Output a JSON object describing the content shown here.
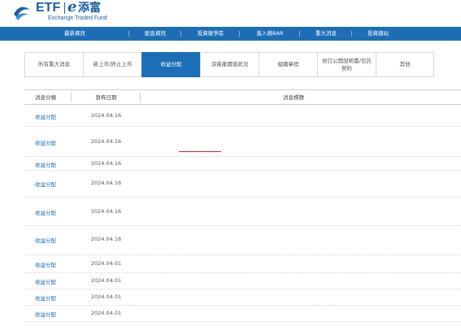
{
  "brand": {
    "etf": "ETF",
    "separator": "|",
    "e_mark": "e",
    "chinese": "添富",
    "subtitle": "Exchange Traded Fund",
    "logo_icon": "wave-logo-icon",
    "color": "#1a5fa0"
  },
  "top_nav": {
    "color": "#1c6fb7",
    "items": [
      "最新資訊",
      "配息資訊",
      "投資競爭區",
      "進入競BAR",
      "重大消息",
      "投資總站"
    ]
  },
  "tabs": {
    "active_index": 2,
    "items": [
      "所有重大消息",
      "新上市/終止上市",
      "收益分配",
      "淨資產價值狀況",
      "組織章程",
      "修訂公開說明書/信託契約",
      "其他"
    ]
  },
  "table": {
    "headers": {
      "category": "消息分類",
      "date": "發佈日期",
      "title": "消息標題"
    },
    "rows": [
      {
        "category": "收益分配",
        "date": "2024.04.16",
        "title": ""
      },
      {
        "category": "收益分配",
        "date": "2024.04.16",
        "title": ""
      },
      {
        "category": "收益分配",
        "date": "2024.04.16",
        "title": ""
      },
      {
        "category": "收益分配",
        "date": "2024.04.16",
        "title": ""
      },
      {
        "category": "收益分配",
        "date": "2024.04.16",
        "title": ""
      },
      {
        "category": "收益分配",
        "date": "2024.04.16",
        "title": ""
      },
      {
        "category": "收益分配",
        "date": "2024.04.01",
        "title": ""
      },
      {
        "category": "收益分配",
        "date": "2024.04.01",
        "title": ""
      },
      {
        "category": "收益分配",
        "date": "2024.04.01",
        "title": ""
      },
      {
        "category": "收益分配",
        "date": "2024.04.01",
        "title": ""
      }
    ]
  },
  "highlight_color": "#e02020"
}
